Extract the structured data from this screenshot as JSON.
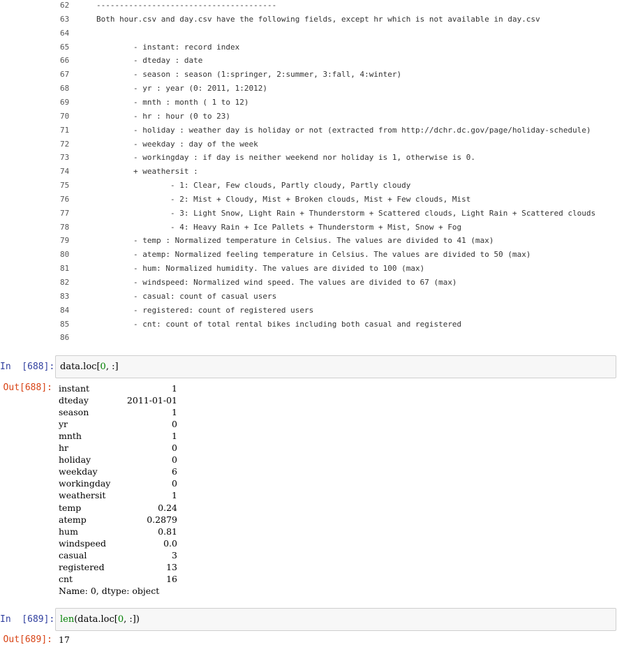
{
  "file_lines": [
    {
      "no": "62",
      "text": "---------------------------------------"
    },
    {
      "no": "63",
      "text": "Both hour.csv and day.csv have the following fields, except hr which is not available in day.csv"
    },
    {
      "no": "64",
      "text": ""
    },
    {
      "no": "65",
      "text": "        - instant: record index"
    },
    {
      "no": "66",
      "text": "        - dteday : date"
    },
    {
      "no": "67",
      "text": "        - season : season (1:springer, 2:summer, 3:fall, 4:winter)"
    },
    {
      "no": "68",
      "text": "        - yr : year (0: 2011, 1:2012)"
    },
    {
      "no": "69",
      "text": "        - mnth : month ( 1 to 12)"
    },
    {
      "no": "70",
      "text": "        - hr : hour (0 to 23)"
    },
    {
      "no": "71",
      "text": "        - holiday : weather day is holiday or not (extracted from http://dchr.dc.gov/page/holiday-schedule)"
    },
    {
      "no": "72",
      "text": "        - weekday : day of the week"
    },
    {
      "no": "73",
      "text": "        - workingday : if day is neither weekend nor holiday is 1, otherwise is 0."
    },
    {
      "no": "74",
      "text": "        + weathersit :"
    },
    {
      "no": "75",
      "text": "                - 1: Clear, Few clouds, Partly cloudy, Partly cloudy"
    },
    {
      "no": "76",
      "text": "                - 2: Mist + Cloudy, Mist + Broken clouds, Mist + Few clouds, Mist"
    },
    {
      "no": "77",
      "text": "                - 3: Light Snow, Light Rain + Thunderstorm + Scattered clouds, Light Rain + Scattered clouds"
    },
    {
      "no": "78",
      "text": "                - 4: Heavy Rain + Ice Pallets + Thunderstorm + Mist, Snow + Fog"
    },
    {
      "no": "79",
      "text": "        - temp : Normalized temperature in Celsius. The values are divided to 41 (max)"
    },
    {
      "no": "80",
      "text": "        - atemp: Normalized feeling temperature in Celsius. The values are divided to 50 (max)"
    },
    {
      "no": "81",
      "text": "        - hum: Normalized humidity. The values are divided to 100 (max)"
    },
    {
      "no": "82",
      "text": "        - windspeed: Normalized wind speed. The values are divided to 67 (max)"
    },
    {
      "no": "83",
      "text": "        - casual: count of casual users"
    },
    {
      "no": "84",
      "text": "        - registered: count of registered users"
    },
    {
      "no": "85",
      "text": "        - cnt: count of total rental bikes including both casual and registered"
    },
    {
      "no": "86",
      "text": ""
    }
  ],
  "cell1": {
    "in_prompt": "In  [688]:",
    "code_prefix": "data.loc[",
    "code_num": "0",
    "code_suffix": ", :]",
    "out_prompt": "Out[688]:",
    "series": [
      {
        "key": "instant",
        "value": "1"
      },
      {
        "key": "dteday",
        "value": "2011-01-01"
      },
      {
        "key": "season",
        "value": "1"
      },
      {
        "key": "yr",
        "value": "0"
      },
      {
        "key": "mnth",
        "value": "1"
      },
      {
        "key": "hr",
        "value": "0"
      },
      {
        "key": "holiday",
        "value": "0"
      },
      {
        "key": "weekday",
        "value": "6"
      },
      {
        "key": "workingday",
        "value": "0"
      },
      {
        "key": "weathersit",
        "value": "1"
      },
      {
        "key": "temp",
        "value": "0.24"
      },
      {
        "key": "atemp",
        "value": "0.2879"
      },
      {
        "key": "hum",
        "value": "0.81"
      },
      {
        "key": "windspeed",
        "value": "0.0"
      },
      {
        "key": "casual",
        "value": "3"
      },
      {
        "key": "registered",
        "value": "13"
      },
      {
        "key": "cnt",
        "value": "16"
      }
    ],
    "footer": "Name: 0, dtype: object"
  },
  "cell2": {
    "in_prompt": "In  [689]:",
    "code_fn": "len",
    "code_mid": "(data.loc[",
    "code_num": "0",
    "code_suffix": ", :])",
    "out_prompt": "Out[689]:",
    "result": "17"
  }
}
